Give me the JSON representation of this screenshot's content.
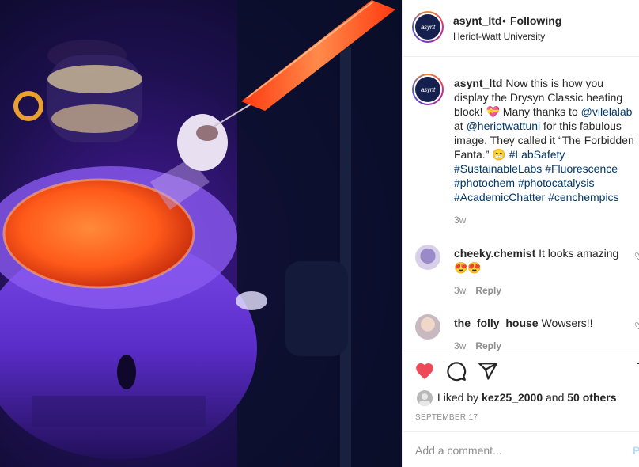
{
  "photo": {
    "alt_subject": "fluorescent-reaction-photo"
  },
  "header": {
    "username": "asynt_ltd",
    "separator": "•",
    "follow_status": "Following",
    "location": "Heriot-Watt University",
    "avatar_text": "asynt"
  },
  "caption": {
    "username": "asynt_ltd",
    "text_1": "Now this is how you display the Drysyn Classic heating block! ",
    "emoji_heart": "💝",
    "text_2": " Many thanks to ",
    "mention_1": "@vilelalab",
    "text_3": " at ",
    "mention_2": "@heriotwattuni",
    "text_4": " for this fabulous image. They called it “The Forbidden Fanta.” ",
    "emoji_grin": "😁",
    "hashtag_1": "#LabSafety",
    "hashtag_2": "#SustainableLabs",
    "hashtag_3": "#Fluorescence",
    "hashtag_4": "#photochem",
    "hashtag_5": "#photocatalysis",
    "hashtag_6": "#AcademicChatter",
    "hashtag_7": "#cenchempics",
    "age": "3w"
  },
  "comments": [
    {
      "username": "cheeky.chemist",
      "text": "It looks amazing",
      "emoji": "😍😍",
      "age": "3w",
      "reply_label": "Reply"
    },
    {
      "username": "the_folly_house",
      "text": "Wowsers!!",
      "age": "3w",
      "reply_label": "Reply"
    }
  ],
  "likes": {
    "prefix": "Liked by",
    "user": "kez25_2000",
    "joiner": "and",
    "others": "50 others"
  },
  "date": "SEPTEMBER 17",
  "add_comment": {
    "placeholder": "Add a comment...",
    "post_label": "Post"
  },
  "colors": {
    "liked_heart": "#ed4956",
    "link": "#00376b",
    "muted": "#8e8e8e",
    "post_button_disabled": "#b2dffc"
  }
}
